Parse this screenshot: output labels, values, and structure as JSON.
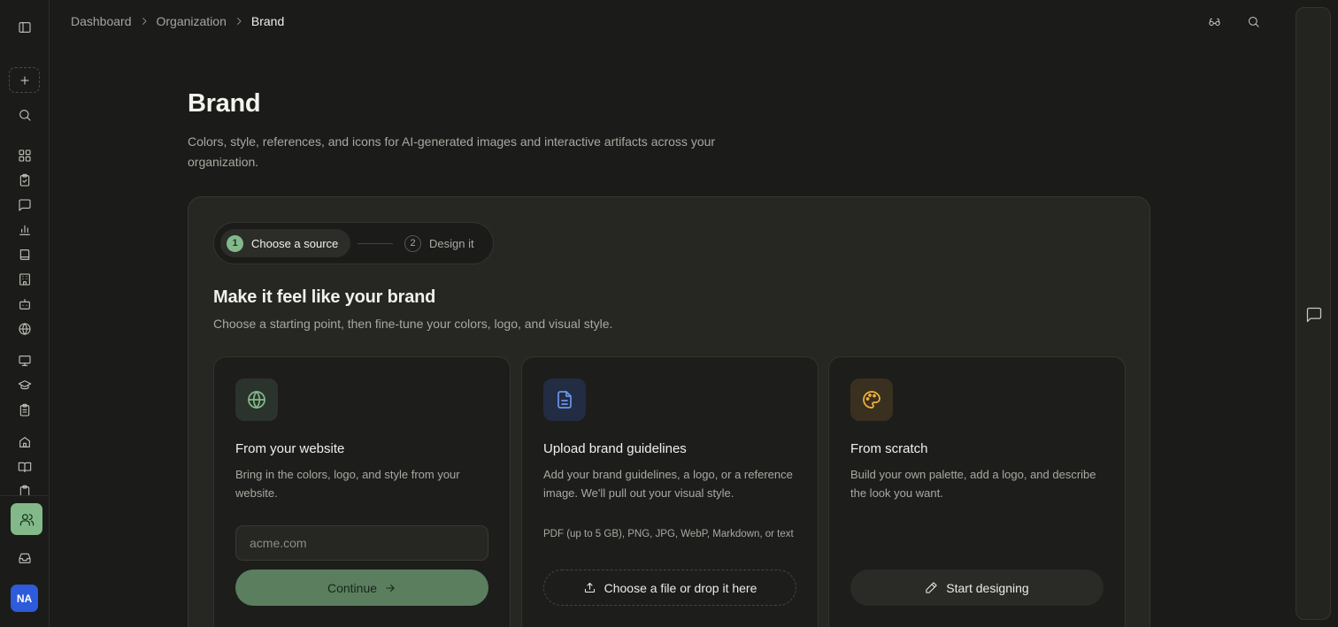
{
  "breadcrumb": {
    "items": [
      "Dashboard",
      "Organization"
    ],
    "current": "Brand"
  },
  "sidebar": {
    "new_button_icon": "plus-icon",
    "nav_icons": [
      "layout-icon",
      "clipboard-check-icon",
      "message-square-icon",
      "bar-chart-icon",
      "book-icon",
      "building-icon",
      "bot-icon",
      "globe-icon",
      "presentation-icon",
      "graduation-cap-icon",
      "clipboard-list-icon",
      "home-icon",
      "book-open-icon",
      "clipboard-icon"
    ],
    "active_item_icon": "users-icon",
    "inbox_icon": "inbox-icon",
    "avatar_initials": "NA"
  },
  "colors": {
    "accent_green": "#83b98a",
    "avatar_blue": "#2e5bdb",
    "background": "#1b1b19"
  },
  "page": {
    "title": "Brand",
    "description": "Colors, style, references, and icons for AI-generated images and interactive artifacts across your organization."
  },
  "stepper": {
    "steps": [
      {
        "number": "1",
        "label": "Choose a source",
        "active": true
      },
      {
        "number": "2",
        "label": "Design it",
        "active": false
      }
    ]
  },
  "section": {
    "title": "Make it feel like your brand",
    "description": "Choose a starting point, then fine-tune your colors, logo, and visual style."
  },
  "cards": [
    {
      "icon": "globe-icon",
      "title": "From your website",
      "description": "Bring in the colors, logo, and style from your website.",
      "input_placeholder": "acme.com",
      "button_label": "Continue"
    },
    {
      "icon": "file-text-icon",
      "title": "Upload brand guidelines",
      "description": "Add your brand guidelines, a logo, or a reference image. We'll pull out your visual style.",
      "note": "PDF (up to 5 GB), PNG, JPG, WebP, Markdown, or text",
      "button_label": "Choose a file or drop it here"
    },
    {
      "icon": "palette-icon",
      "title": "From scratch",
      "description": "Build your own palette, add a logo, and describe the look you want.",
      "button_label": "Start designing"
    }
  ]
}
